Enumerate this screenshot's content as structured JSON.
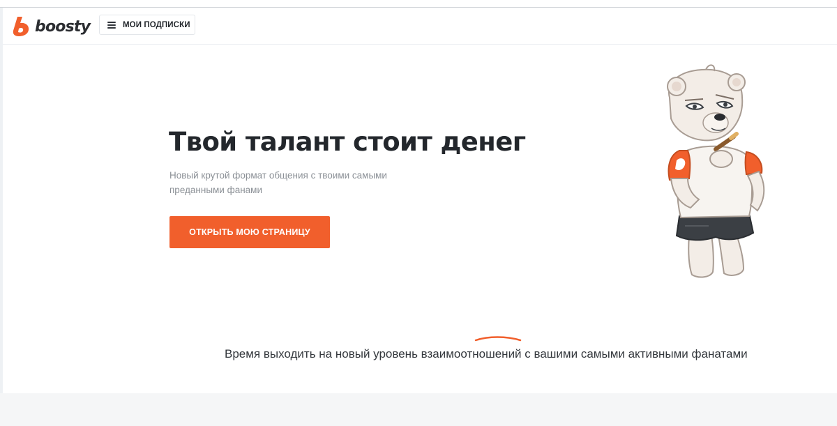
{
  "header": {
    "logo_text": "boosty",
    "subscriptions_label": "МОИ ПОДПИСКИ",
    "brand_color": "#f15f2c"
  },
  "hero": {
    "title": "Твой талант стоит денег",
    "subtitle": "Новый крутой формат общения с твоими самыми преданными фанами",
    "cta_label": "ОТКРЫТЬ МОЮ СТРАНИЦУ"
  },
  "tagline": "Время выходить на новый уровень взаимоотношений с вашими самыми активными фанатами",
  "icons": {
    "logo": "boosty-logo-icon",
    "menu": "hamburger-menu-icon",
    "mascot": "bear-mascot-illustration"
  }
}
